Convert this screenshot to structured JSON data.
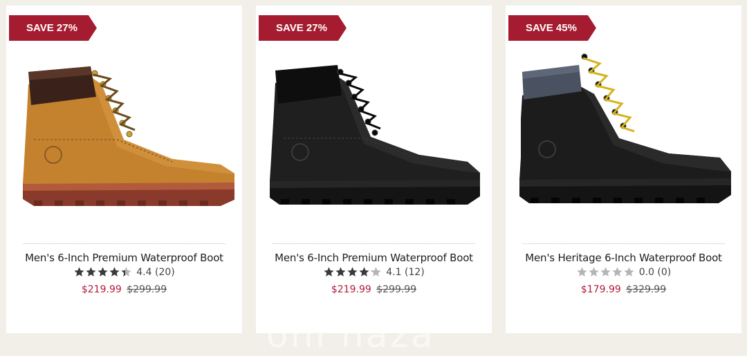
{
  "products": [
    {
      "badge": "SAVE 27%",
      "title": "Men's 6-Inch Premium Waterproof Boot",
      "rating": 4.4,
      "rating_label": "4.4 (20)",
      "sale_price": "$219.99",
      "original_price": "$299.99",
      "image": "wheat-boot-image"
    },
    {
      "badge": "SAVE 27%",
      "title": "Men's 6-Inch Premium Waterproof Boot",
      "rating": 4.1,
      "rating_label": "4.1 (12)",
      "sale_price": "$219.99",
      "original_price": "$299.99",
      "image": "black-boot-image"
    },
    {
      "badge": "SAVE 45%",
      "title": "Men's Heritage 6-Inch Waterproof Boot",
      "rating": 0.0,
      "rating_label": "0.0 (0)",
      "sale_price": "$179.99",
      "original_price": "$329.99",
      "image": "black-grey-collar-boot-image"
    }
  ],
  "colors": {
    "badge": "#a51c30",
    "sale_price": "#b2193b",
    "star_filled": "#3a3a3a",
    "star_empty": "#b5b5b5"
  }
}
